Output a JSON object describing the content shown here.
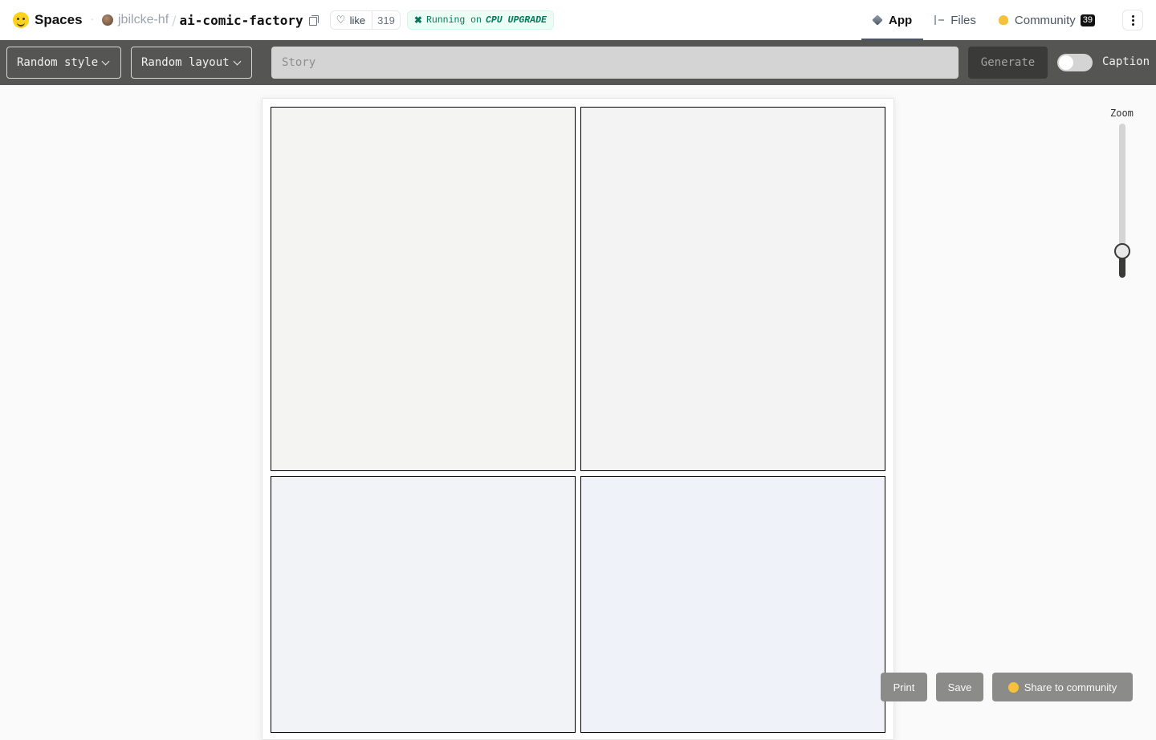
{
  "header": {
    "brand": "Spaces",
    "owner": "jbilcke-hf",
    "repo": "ai-comic-factory",
    "like_label": "like",
    "like_count": "319",
    "status_prefix": "Running on",
    "status_hardware": "CPU UPGRADE",
    "tabs": [
      {
        "label": "App",
        "active": true
      },
      {
        "label": "Files",
        "active": false
      },
      {
        "label": "Community",
        "active": false,
        "badge": "39"
      }
    ]
  },
  "toolbar": {
    "style_select": "Random style",
    "layout_select": "Random layout",
    "story_placeholder": "Story",
    "story_value": "",
    "generate_label": "Generate",
    "caption_label": "Caption",
    "caption_enabled": false
  },
  "comic": {
    "panel_colors": [
      "#f4f4f2",
      "#f3f3f3",
      "#f1f3f6",
      "#eff3f9"
    ]
  },
  "zoom": {
    "label": "Zoom",
    "value_fraction": 0.17
  },
  "actions": {
    "print_label": "Print",
    "save_label": "Save",
    "share_label": "Share to community"
  }
}
